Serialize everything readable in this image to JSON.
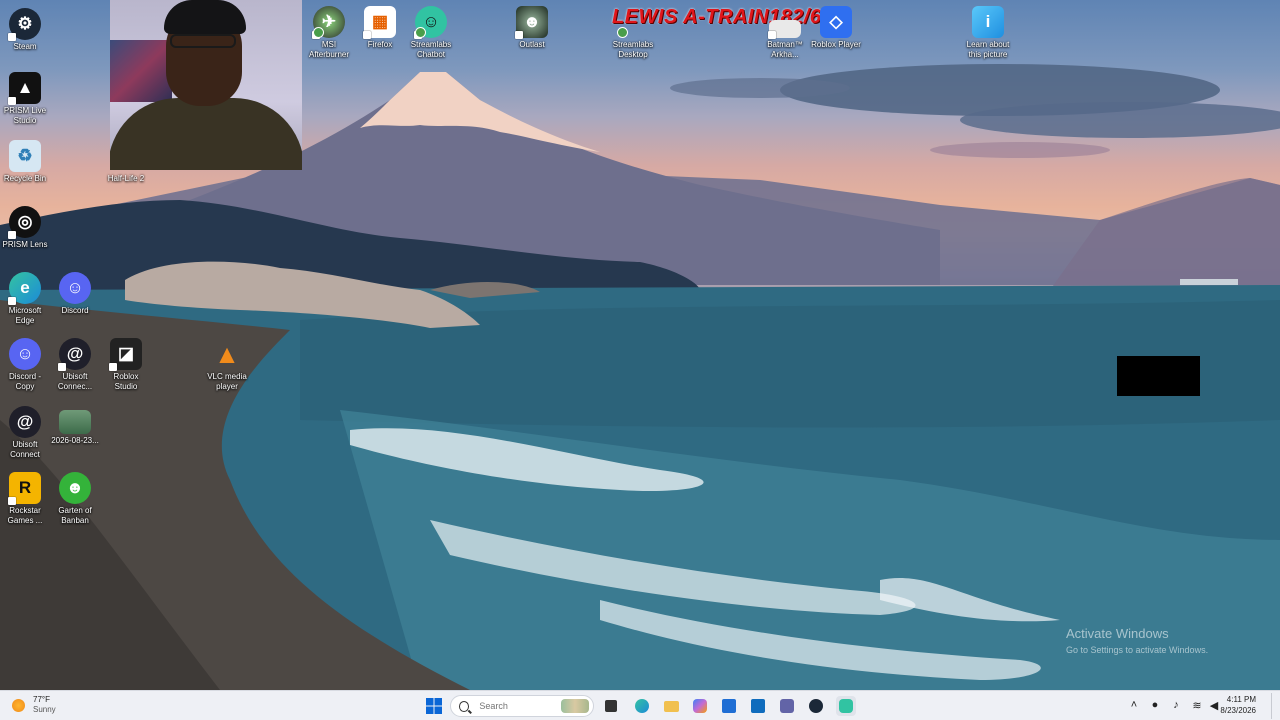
{
  "desktop": {
    "icons": [
      {
        "label": "Steam",
        "icon": "steam-icon",
        "color": "#1b2838"
      },
      {
        "label": "PRISM Live\nStudio",
        "icon": "prism-live-icon",
        "color": "#111111"
      },
      {
        "label": "Recycle Bin",
        "icon": "recycle-bin-icon",
        "color": "#d6e7f3"
      },
      {
        "label": "Half-Life 2",
        "icon": "half-life-icon",
        "color": "#b5482a"
      },
      {
        "label": "PRISM Lens",
        "icon": "prism-lens-icon",
        "color": "#111111"
      },
      {
        "label": "Microsoft\nEdge",
        "icon": "edge-icon",
        "color": "#1c8bd8"
      },
      {
        "label": "Discord",
        "icon": "discord-icon",
        "color": "#5865f2"
      },
      {
        "label": "Discord -\nCopy",
        "icon": "discord-icon",
        "color": "#5865f2"
      },
      {
        "label": "Ubisoft\nConnec...",
        "icon": "ubisoft-icon",
        "color": "#1f1f2a"
      },
      {
        "label": "Roblox\nStudio",
        "icon": "roblox-studio-icon",
        "color": "#222222"
      },
      {
        "label": "VLC media\nplayer",
        "icon": "vlc-icon",
        "color": "#f18b1b"
      },
      {
        "label": "Ubisoft\nConnect",
        "icon": "ubisoft-icon",
        "color": "#1f1f2a"
      },
      {
        "label": "2026-08-23...",
        "icon": "video-file-icon",
        "color": "#3d6b4a"
      },
      {
        "label": "Rockstar\nGames ...",
        "icon": "rockstar-icon",
        "color": "#f4b400"
      },
      {
        "label": "Garten of\nBanban",
        "icon": "garten-icon",
        "color": "#34b33a"
      },
      {
        "label": "MSI\nAfterburner",
        "icon": "msi-afterburner-icon",
        "color": "#2a2a2a"
      },
      {
        "label": "Firefox",
        "icon": "firefox-icon",
        "color": "#ffffff"
      },
      {
        "label": "Streamlabs\nChatbot",
        "icon": "streamlabs-chatbot-icon",
        "color": "#31c3a2"
      },
      {
        "label": "Outlast",
        "icon": "outlast-icon",
        "color": "#1c2a20"
      },
      {
        "label": "Streamlabs\nDesktop",
        "icon": "streamlabs-desktop-icon",
        "color": "#31c3a2"
      },
      {
        "label": "Batman™\nArkha...",
        "icon": "batman-icon",
        "color": "#e9e9e9"
      },
      {
        "label": "Roblox Player",
        "icon": "roblox-player-icon",
        "color": "#2f6ff0"
      },
      {
        "label": "Learn about\nthis picture",
        "icon": "learn-picture-icon",
        "color": "#1f8fe0"
      }
    ]
  },
  "overlay": {
    "stream_title": "LEWIS A-TRAIN182/600"
  },
  "watermark": {
    "title": "Activate Windows",
    "subtitle": "Go to Settings to activate Windows."
  },
  "taskbar": {
    "weather": {
      "temp": "77°F",
      "condition": "Sunny",
      "icon": "sun-icon"
    },
    "search_placeholder": "Search",
    "pinned": [
      {
        "icon": "windows-start-icon",
        "color": "#0a66d6"
      },
      {
        "icon": "file-explorer-icon",
        "color": "#f5b93b"
      },
      {
        "icon": "edge-icon",
        "color": "#1c8bd8"
      },
      {
        "icon": "folder-icon",
        "color": "#f1c04f"
      },
      {
        "icon": "copilot-icon",
        "color": "#c36bd6"
      },
      {
        "icon": "store-icon",
        "color": "#1f6ed4"
      },
      {
        "icon": "outlook-icon",
        "color": "#0f6cbd"
      },
      {
        "icon": "teams-icon",
        "color": "#6264a7"
      },
      {
        "icon": "steam-icon",
        "color": "#1b2838"
      },
      {
        "icon": "streamlabs-icon",
        "color": "#31c3a2"
      }
    ],
    "clock": {
      "time": "4:11 PM",
      "date": "8/23/2026"
    }
  }
}
